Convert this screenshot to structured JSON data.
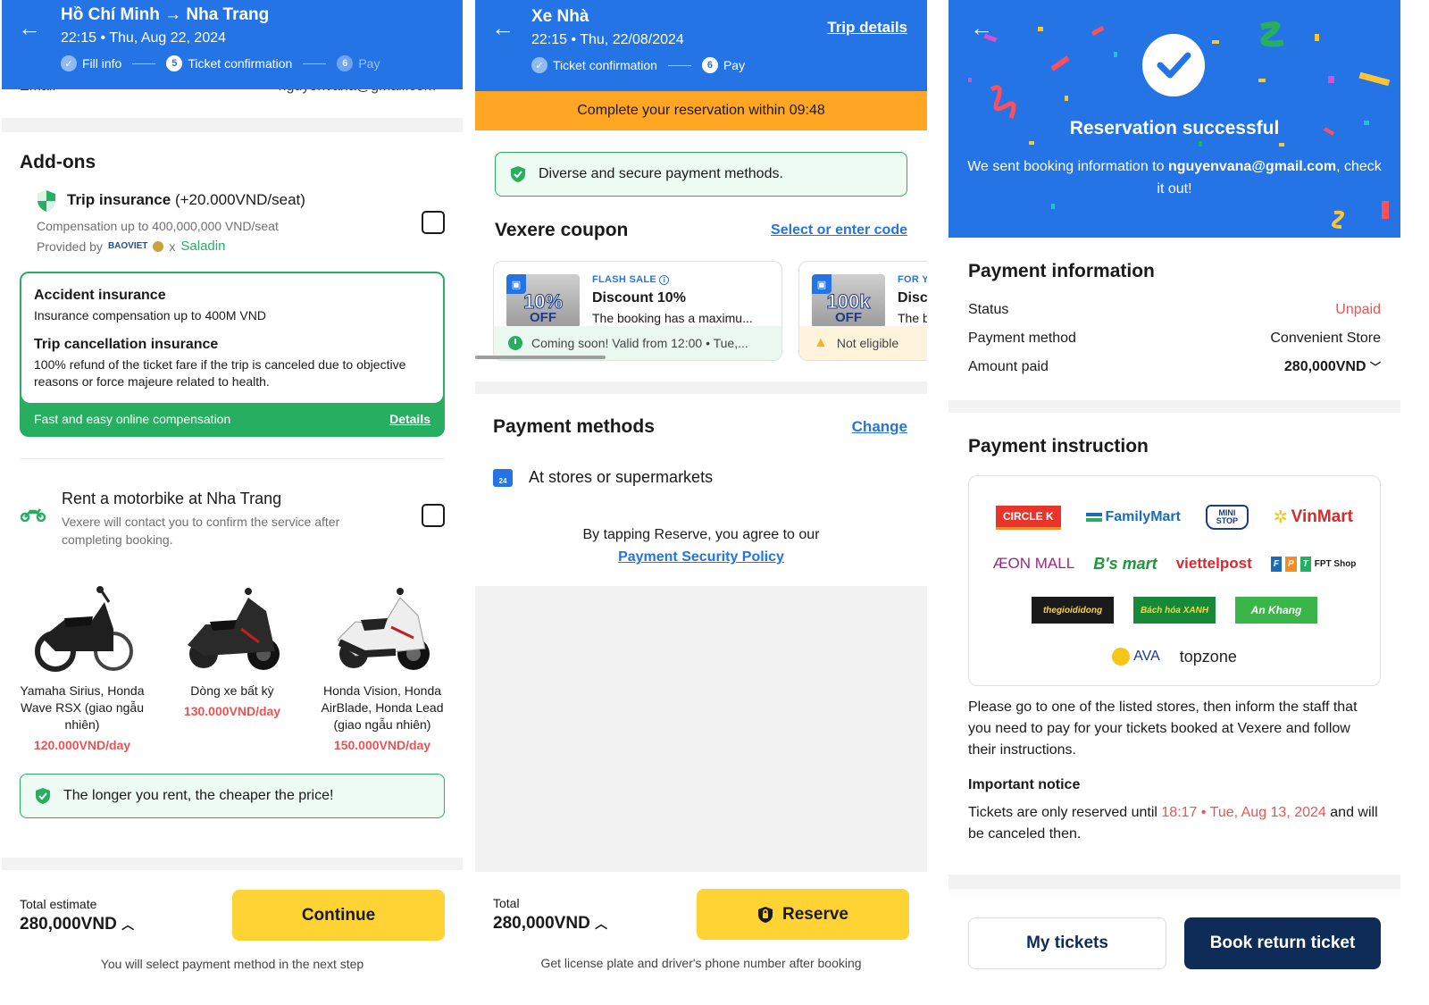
{
  "panel1": {
    "header": {
      "title": "Hồ Chí Minh → Nha Trang",
      "subtitle": "22:15 • Thu, Aug 22, 2024",
      "steps": [
        {
          "num": "✓",
          "label": "Fill info",
          "state": "done"
        },
        {
          "num": "5",
          "label": "Ticket confirmation",
          "state": "current"
        },
        {
          "num": "6",
          "label": "Pay",
          "state": "next"
        }
      ]
    },
    "email_row": {
      "label": "Email",
      "value": "nguyenvana@gmail.com"
    },
    "addons": {
      "title": "Add-ons",
      "insurance": {
        "title": "Trip insurance",
        "price": "(+20.000VND/seat)",
        "compensation": "Compensation up to 400,000,000 VND/seat",
        "provided_by": "Provided by",
        "provider1": "BAOVIET",
        "provider_x": "x",
        "provider2": "Saladin",
        "checked": false,
        "details": [
          {
            "title": "Accident insurance",
            "desc": "Insurance compensation up to 400M VND"
          },
          {
            "title": "Trip cancellation insurance",
            "desc": "100% refund of the ticket fare if the trip is canceled due to objective reasons or force majeure related to health."
          }
        ],
        "footer_text": "Fast and easy online compensation",
        "footer_link": "Details"
      },
      "motorbike": {
        "title": "Rent a motorbike at Nha Trang",
        "desc": "Vexere will contact you to confirm the service after completing booking.",
        "checked": false,
        "options": [
          {
            "name": "Yamaha Sirius, Honda Wave RSX (giao ngẫu nhiên)",
            "price": "120.000VND/day",
            "color": "#1f1f1f"
          },
          {
            "name": "Dòng xe bất kỳ",
            "price": "130.000VND/day",
            "color": "#2a2a2a"
          },
          {
            "name": "Honda Vision, Honda AirBlade, Honda Lead (giao ngẫu nhiên)",
            "price": "150.000VND/day",
            "color": "#e8e8e8"
          }
        ],
        "promo": "The longer you rent, the cheaper the price!"
      }
    },
    "footer": {
      "total_label": "Total estimate",
      "total_value": "280,000VND",
      "button": "Continue",
      "note": "You will select payment method in the next step"
    }
  },
  "panel2": {
    "header": {
      "title": "Xe Nhà",
      "subtitle": "22:15 • Thu, 22/08/2024",
      "trip_details": "Trip details",
      "steps": [
        {
          "num": "✓",
          "label": "Ticket confirmation",
          "state": "done"
        },
        {
          "num": "6",
          "label": "Pay",
          "state": "current"
        }
      ]
    },
    "timer": {
      "text": "Complete your reservation within",
      "time": "09:48"
    },
    "secure_note": "Diverse and secure payment methods.",
    "coupon": {
      "title": "Vexere coupon",
      "link": "Select or enter code",
      "items": [
        {
          "badge": "10%",
          "tag": "FLASH SALE",
          "title": "Discount 10%",
          "desc": "The booking has a maximu...",
          "status": "Coming soon! Valid from 12:00 • Tue,...",
          "status_type": "soon"
        },
        {
          "badge": "100k",
          "tag": "FOR Y",
          "title": "Disc",
          "desc": "The b",
          "status": "Not eligible",
          "status_type": "warn"
        }
      ],
      "off_label": "OFF"
    },
    "payment": {
      "title": "Payment methods",
      "change": "Change",
      "method": "At stores or supermarkets",
      "agree": "By tapping Reserve, you agree to our",
      "policy": "Payment Security Policy"
    },
    "footer": {
      "total_label": "Total",
      "total_value": "280,000VND",
      "button": "Reserve",
      "note": "Get license plate and driver's phone number after booking"
    }
  },
  "panel3": {
    "success": {
      "title": "Reservation successful",
      "msg_pre": "We sent booking information to",
      "email": "nguyenvana@gmail.com",
      "msg_post": ", check it out!"
    },
    "payment_info": {
      "title": "Payment information",
      "rows": [
        {
          "label": "Status",
          "value": "Unpaid"
        },
        {
          "label": "Payment method",
          "value": "Convenient Store"
        },
        {
          "label": "Amount paid",
          "value": "280,000VND"
        }
      ]
    },
    "instruction": {
      "title": "Payment instruction",
      "stores": [
        "CIRCLE K",
        "FamilyMart",
        "MINI STOP",
        "VinMart",
        "ÆON MALL",
        "B's mart",
        "viettelpost",
        "FPT Shop",
        "thegioididong",
        "Bách hóa XANH",
        "An Khang",
        "AVA",
        "topzone"
      ],
      "text": "Please go to one of the listed stores, then inform the staff that you need to pay for your tickets booked at Vexere and follow their instructions.",
      "notice_title": "Important notice",
      "notice_pre": "Tickets are only reserved until",
      "notice_time": "18:17 • Tue, Aug 13, 2024",
      "notice_post": "and will be canceled then."
    },
    "buttons": {
      "my_tickets": "My tickets",
      "book_return": "Book return ticket"
    }
  },
  "colors": {
    "primary": "#2474e5",
    "success": "#27ae60",
    "warning": "#ffa724",
    "cta": "#ffd333",
    "danger": "#eb5353",
    "navy": "#0f2c59"
  }
}
